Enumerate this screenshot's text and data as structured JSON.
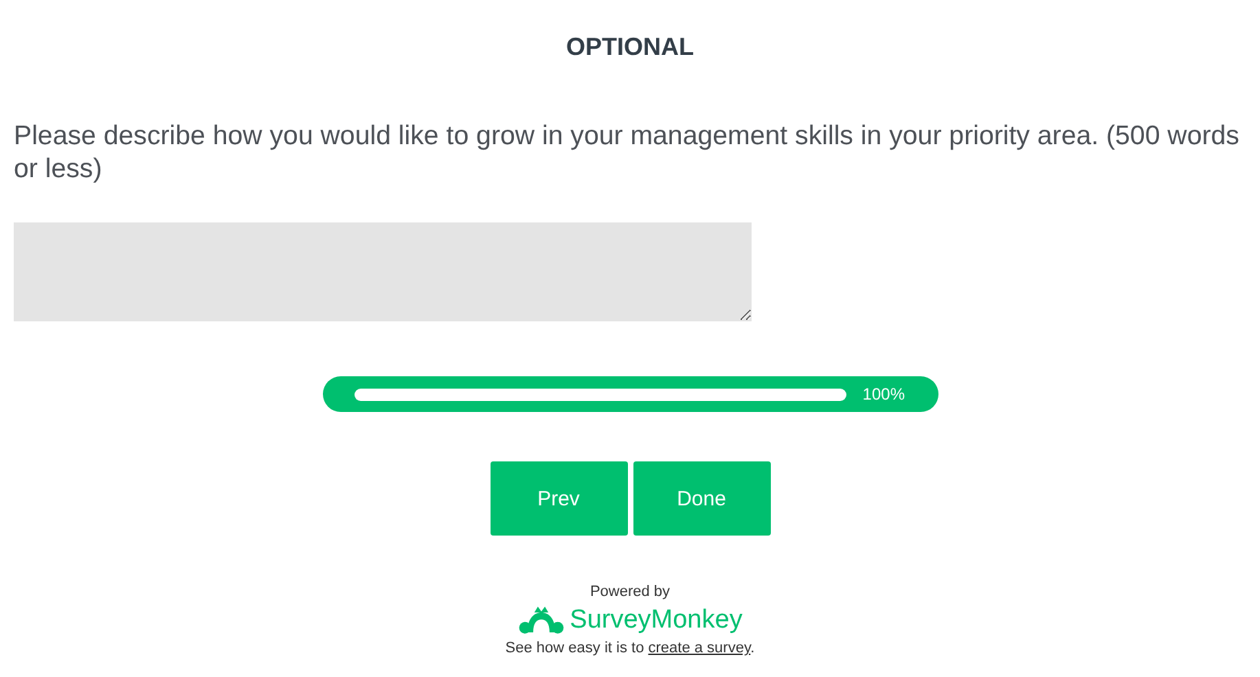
{
  "heading": "OPTIONAL",
  "question": "Please describe how you would like to grow in your management skills in your priority area. (500 words or less)",
  "progress": {
    "level": 1,
    "reading": "100%"
  },
  "buttons": [
    "Prev",
    "Done"
  ],
  "footer": {
    "powered_by": "Powered by",
    "brand": "SurveyMonkey",
    "sentence_start": "See how easy it is to ",
    "link": "create a survey",
    "sentence_end": "."
  }
}
